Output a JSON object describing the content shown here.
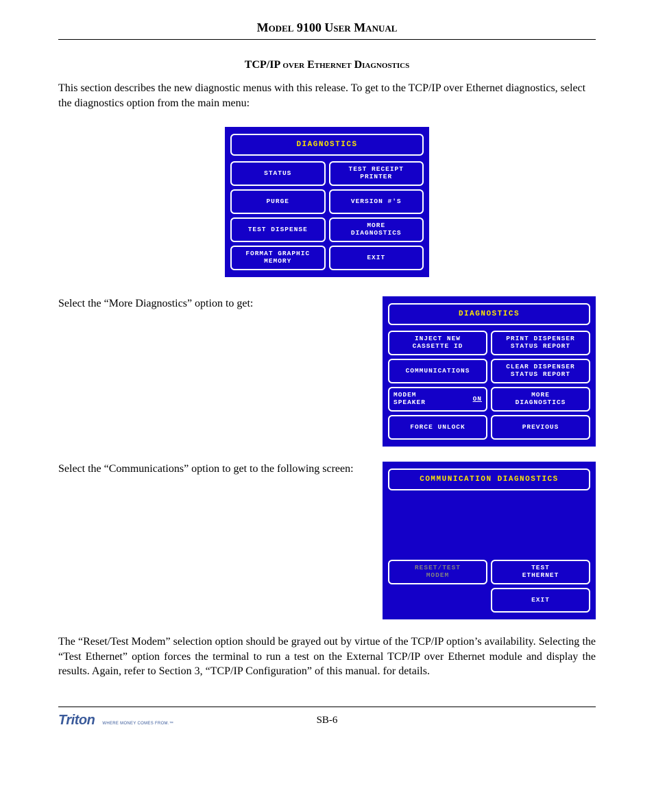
{
  "header": "Model 9100 User Manual",
  "section_title": "TCP/IP over Ethernet Diagnostics",
  "intro": "This section describes the new diagnostic menus with this release.  To get to the TCP/IP over Ethernet diagnostics, select the diagnostics option from the main menu:",
  "screen1": {
    "title": "DIAGNOSTICS",
    "buttons": [
      {
        "label": "STATUS"
      },
      {
        "label": "TEST RECEIPT\nPRINTER"
      },
      {
        "label": "PURGE"
      },
      {
        "label": "VERSION #'S"
      },
      {
        "label": "TEST DISPENSE"
      },
      {
        "label": "MORE\nDIAGNOSTICS"
      },
      {
        "label": "FORMAT GRAPHIC\nMEMORY"
      },
      {
        "label": "EXIT"
      }
    ]
  },
  "text2": "Select the “More Diagnostics” option to get:",
  "screen2": {
    "title": "DIAGNOSTICS",
    "buttons": [
      {
        "label": "INJECT NEW\nCASSETTE ID"
      },
      {
        "label": "PRINT DISPENSER\nSTATUS REPORT"
      },
      {
        "label": "COMMUNICATIONS"
      },
      {
        "label": "CLEAR DISPENSER\nSTATUS REPORT"
      },
      {
        "label_left": "MODEM\nSPEAKER",
        "label_right": "ON"
      },
      {
        "label": "MORE\nDIAGNOSTICS"
      },
      {
        "label": "FORCE UNLOCK"
      },
      {
        "label": "PREVIOUS"
      }
    ]
  },
  "text3": "Select the “Communications” option to get to the following screen:",
  "screen3": {
    "title": "COMMUNICATION DIAGNOSTICS",
    "buttons": [
      {
        "label": "RESET/TEST\nMODEM",
        "grayed": true
      },
      {
        "label": "TEST\nETHERNET"
      },
      {
        "label": "EXIT"
      }
    ]
  },
  "body_para": "The “Reset/Test Modem” selection option should be grayed out by virtue of the TCP/IP option’s availability.  Selecting the “Test Ethernet” option forces the terminal to run a test on the External TCP/IP over Ethernet module and display the results.  Again, refer to Section 3, “TCP/IP Configuration” of this manual. for details.",
  "page_num": "SB-6",
  "logo": "Triton",
  "logo_tag": "WHERE MONEY COMES FROM.™"
}
